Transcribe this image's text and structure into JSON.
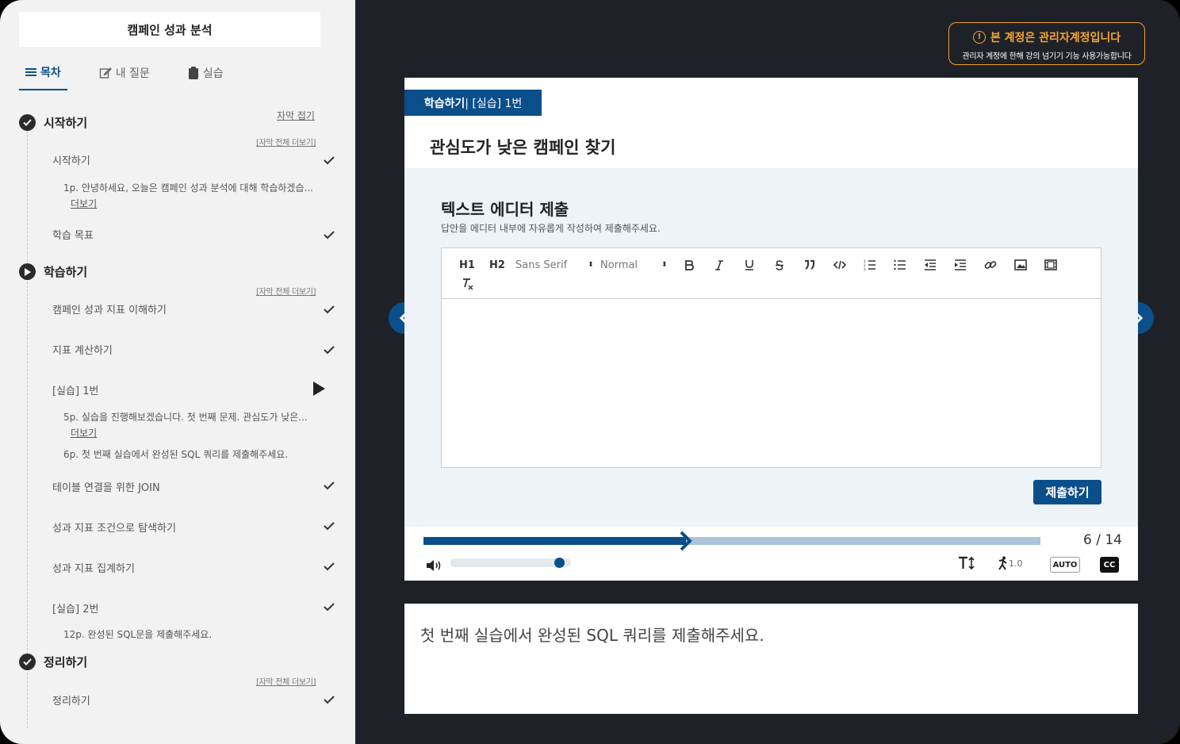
{
  "sidebar": {
    "course_title": "캠페인 성과 분석",
    "tabs": [
      {
        "label": "목차",
        "icon": "list-icon"
      },
      {
        "label": "내 질문",
        "icon": "edit-icon"
      },
      {
        "label": "실습",
        "icon": "clipboard-icon"
      }
    ],
    "subtitle_fold": "자막 접기",
    "expand_all": "[자막 전체 더보기]",
    "more_label": "더보기",
    "sections": [
      {
        "title": "시작하기",
        "status": "completed",
        "items": [
          {
            "label": "시작하기",
            "status": "completed",
            "subs": [
              "1p. 안녕하세요, 오늘은 캠페인 성과 분석에 대해 학습하겠습..."
            ]
          },
          {
            "label": "학습 목표",
            "status": "completed"
          }
        ]
      },
      {
        "title": "학습하기",
        "status": "in-progress",
        "items": [
          {
            "label": "캠페인 성과 지표 이해하기",
            "status": "completed"
          },
          {
            "label": "지표 계산하기",
            "status": "completed"
          },
          {
            "label": "[실습] 1번",
            "status": "playing",
            "subs": [
              "5p. 실습을 진행해보겠습니다. 첫 번째 문제. 관심도가 낮은...",
              "6p. 첫 번째 실습에서 완성된 SQL 쿼리를 제출해주세요."
            ]
          },
          {
            "label": "테이블 연결을 위한 JOIN",
            "status": "completed"
          },
          {
            "label": "성과 지표 조건으로 탐색하기",
            "status": "completed"
          },
          {
            "label": "성과 지표 집계하기",
            "status": "completed"
          },
          {
            "label": "[실습] 2번",
            "status": "completed",
            "subs": [
              "12p. 완성된 SQL문을 제출해주세요."
            ]
          }
        ]
      },
      {
        "title": "정리하기",
        "status": "completed",
        "items": [
          {
            "label": "정리하기",
            "status": "completed"
          }
        ]
      }
    ]
  },
  "notice": {
    "title": "본 계정은 관리자계정입니다",
    "subtitle": "관리자 계정에 한해 강의 넘기기 기능 사용가능합니다",
    "icon": "exclamation-icon"
  },
  "content": {
    "chip_strong": "학습하기",
    "chip_rest": " | [실습] 1번",
    "lesson_title": "관심도가 낮은 캠페인 찾기",
    "panel_title": "텍스트 에디터 제출",
    "panel_desc": "답안을 에디터 내부에 자유롭게 작성하여 제출해주세요.",
    "toolbar": {
      "h1": "H1",
      "h2": "H2",
      "font": "Sans Serif",
      "size": "Normal",
      "select_arrow": "⬍"
    },
    "submit_label": "제출하기",
    "progress": {
      "current": 6,
      "total": 14,
      "fraction": 0.426
    },
    "page_count": "6 / 14",
    "volume_level": 0.9,
    "speed": "1.0",
    "auto_label": "AUTO",
    "cc_label": "CC",
    "text_size_label": "T↕"
  },
  "subtitle": {
    "text": "첫 번째 실습에서 완성된 SQL 쿼리를 제출해주세요."
  },
  "colors": {
    "primary": "#0b4f8a",
    "warning": "#f6a733",
    "dark_bg": "#1f2128",
    "sidebar_bg": "#f2f2f2"
  }
}
